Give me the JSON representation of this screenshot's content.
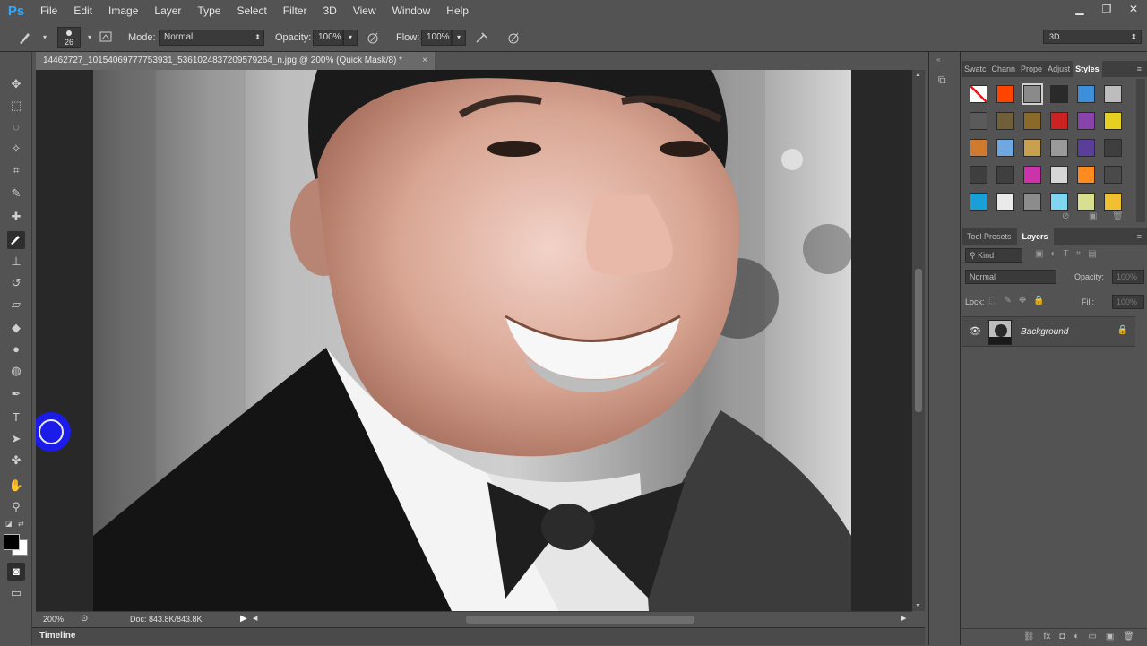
{
  "app": {
    "logo": "Ps"
  },
  "menu": [
    "File",
    "Edit",
    "Image",
    "Layer",
    "Type",
    "Select",
    "Filter",
    "3D",
    "View",
    "Window",
    "Help"
  ],
  "window_controls": {
    "minimize": "▁",
    "restore": "❐",
    "close": "✕"
  },
  "options": {
    "brush_size": "26",
    "mode_label": "Mode:",
    "mode_value": "Normal",
    "opacity_label": "Opacity:",
    "opacity_value": "100%",
    "flow_label": "Flow:",
    "flow_value": "100%",
    "workspace": "3D"
  },
  "document": {
    "tab_title": "14462727_10154069777753931_5361024837209579264_n.jpg @ 200% (Quick Mask/8) *",
    "close": "×",
    "zoom": "200%",
    "doc_info": "Doc: 843.8K/843.8K"
  },
  "timeline": {
    "label": "Timeline"
  },
  "styles_panel": {
    "tabs": [
      "Swatc",
      "Chann",
      "Prope",
      "Adjust",
      "Styles"
    ],
    "active_tab": "Styles",
    "styles": [
      "#ffffff",
      "#ff4400",
      "#8a8a8a",
      "#2a2a2a",
      "#3c8fd8",
      "#bdbdbd",
      "#5a5a5a",
      "#6f5f3a",
      "#8a6a2a",
      "#cc2222",
      "#8844aa",
      "#e6d020",
      "#d07a30",
      "#6fa8e0",
      "#c8a050",
      "#9a9a9a",
      "#5a3e9a",
      "#3f3f3f",
      "#3f3f3f",
      "#3f3f3f",
      "#cc33aa",
      "#d6d6d6",
      "#ff8a20",
      "#4a4a4a",
      "#1aa0d8",
      "#eaeaea",
      "#8c8c8c",
      "#7fd6f0",
      "#d8e090",
      "#f0c030"
    ]
  },
  "layers_panel": {
    "tabs": [
      "Tool Presets",
      "Layers"
    ],
    "active_tab": "Layers",
    "kind": "Kind",
    "blend_mode": "Normal",
    "opacity_label": "Opacity:",
    "opacity_value": "100%",
    "lock_label": "Lock:",
    "fill_label": "Fill:",
    "fill_value": "100%",
    "layer_name": "Background",
    "footer_icons": [
      "link-icon",
      "fx-icon",
      "mask-icon",
      "adjustment-icon",
      "group-icon",
      "new-layer-icon",
      "trash-icon"
    ]
  },
  "colors": {
    "foreground": "#000000",
    "background": "#ffffff",
    "brush_cursor": "#1a1aff"
  }
}
